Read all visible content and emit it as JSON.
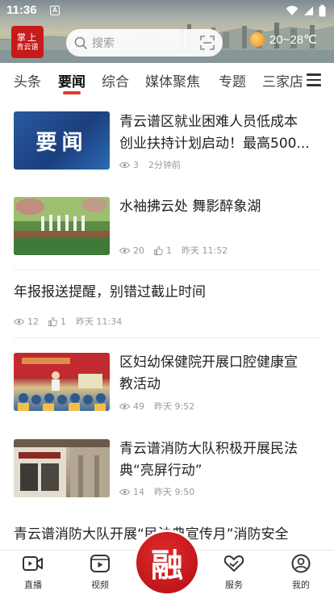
{
  "status_bar": {
    "time": "11:36",
    "sim_label": "A"
  },
  "header": {
    "logo_line1": "掌上",
    "logo_line2": "青云谱",
    "search_placeholder": "搜索",
    "weather": "20~28℃"
  },
  "tabs": [
    {
      "label": "头条",
      "active": false
    },
    {
      "label": "要闻",
      "active": true
    },
    {
      "label": "综合",
      "active": false
    },
    {
      "label": "媒体聚焦",
      "active": false
    },
    {
      "label": "专题",
      "active": false
    },
    {
      "label": "三家店",
      "active": false
    }
  ],
  "news": [
    {
      "title_line1": "青云谱区就业困难人员低成本",
      "title_line2": "创业扶持计划启动！最高500...",
      "views": "3",
      "time": "2分钟前",
      "thumb_text": "要闻"
    },
    {
      "title_line1": "水袖拂云处 舞影醉象湖",
      "views": "20",
      "likes": "1",
      "time": "昨天 11:52"
    },
    {
      "title_line1": "年报报送提醒，别错过截止时间",
      "views": "12",
      "likes": "1",
      "time": "昨天 11:34"
    },
    {
      "title_line1": "区妇幼保健院开展口腔健康宣",
      "title_line2": "教活动",
      "views": "49",
      "time": "昨天 9:52"
    },
    {
      "title_line1": "青云谱消防大队积极开展民法",
      "title_line2": "典“亮屏行动”",
      "views": "14",
      "time": "昨天 9:50"
    },
    {
      "title_line1": "青云谱消防大队开展“民法典宣传月”消防安全"
    }
  ],
  "bottom_nav": {
    "live": "直播",
    "video": "视频",
    "center_glyph": "融",
    "service": "服务",
    "mine": "我的"
  },
  "colors": {
    "accent": "#e23a2e",
    "brand_red": "#c91a1a",
    "meta_gray": "#9a9a9a"
  }
}
